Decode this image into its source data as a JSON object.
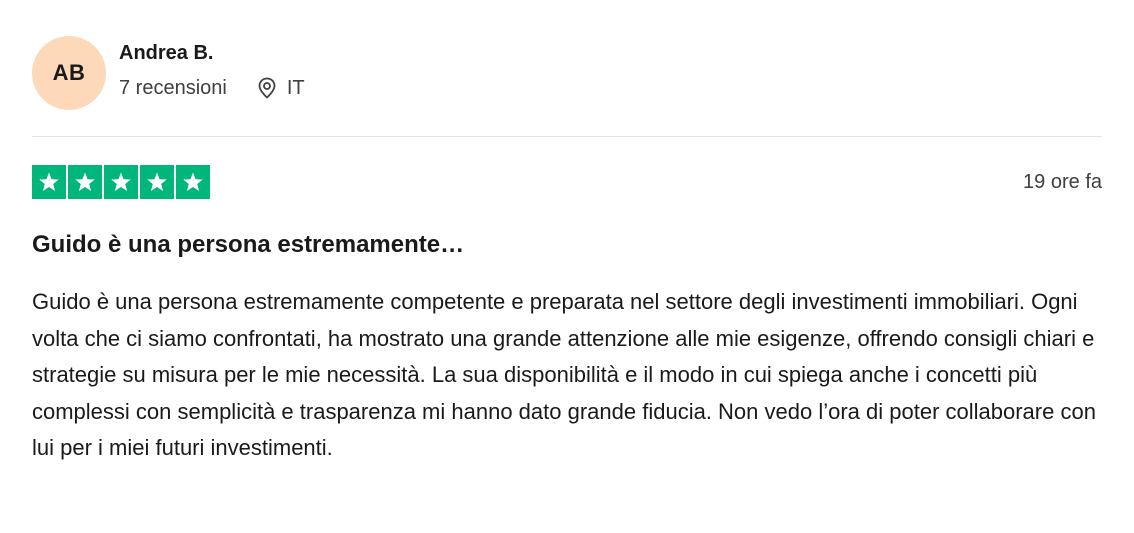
{
  "consumer": {
    "initials": "AB",
    "name": "Andrea B.",
    "review_count": "7 recensioni",
    "country": "IT",
    "avatar_color": "#fdd8b9"
  },
  "review": {
    "rating": 5,
    "star_color": "#00b67a",
    "date": "19 ore fa",
    "title": "Guido è una persona estremamente…",
    "text": "Guido è una persona estremamente competente e preparata nel settore degli investimenti immobiliari. Ogni volta che ci siamo confrontati, ha mostrato una grande attenzione alle mie esigenze, offrendo consigli chiari e strategie su misura per le mie necessità. La sua disponibilità e il modo in cui spiega anche i concetti più complessi con semplicità e trasparenza mi hanno dato grande fiducia. Non vedo l’ora di poter collaborare con lui per i miei futuri investimenti."
  },
  "icons": {
    "location": "location-pin-icon",
    "star": "star-icon"
  }
}
